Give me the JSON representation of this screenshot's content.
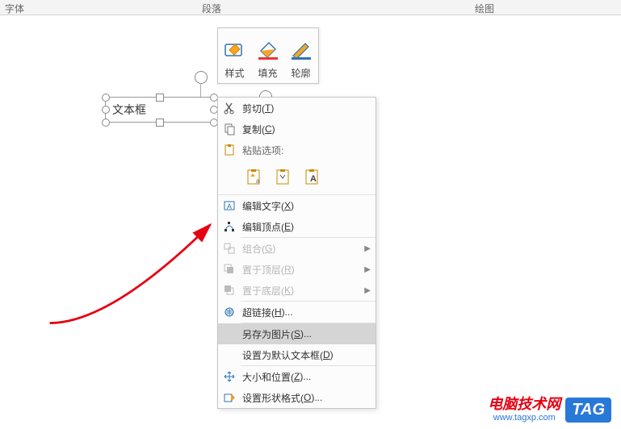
{
  "ribbon": {
    "tab1": "字体",
    "tab2": "段落",
    "tab3": "绘图"
  },
  "toolbar": {
    "btn1": "样式",
    "btn2": "填充",
    "btn3": "轮廓"
  },
  "textbox": {
    "text": "文本框"
  },
  "menu": {
    "cut": {
      "label": "剪切(",
      "accel": "T",
      "suffix": ")"
    },
    "copy": {
      "label": "复制(",
      "accel": "C",
      "suffix": ")"
    },
    "pasteHeader": "粘贴选项:",
    "editText": {
      "label": "编辑文字(",
      "accel": "X",
      "suffix": ")"
    },
    "editPoints": {
      "label": "编辑顶点(",
      "accel": "E",
      "suffix": ")"
    },
    "group": {
      "label": "组合(",
      "accel": "G",
      "suffix": ")"
    },
    "bringFront": {
      "label": "置于顶层(",
      "accel": "R",
      "suffix": ")"
    },
    "sendBack": {
      "label": "置于底层(",
      "accel": "K",
      "suffix": ")"
    },
    "hyperlink": {
      "label": "超链接(",
      "accel": "H",
      "suffix": ")..."
    },
    "saveAsPic": {
      "label": "另存为图片(",
      "accel": "S",
      "suffix": ")..."
    },
    "setDefault": {
      "label": "设置为默认文本框(",
      "accel": "D",
      "suffix": ")"
    },
    "sizePos": {
      "label": "大小和位置(",
      "accel": "Z",
      "suffix": ")..."
    },
    "formatShape": {
      "label": "设置形状格式(",
      "accel": "O",
      "suffix": ")..."
    }
  },
  "watermark": {
    "line1": "电脑技术网",
    "line2": "www.tagxp.com",
    "tag": "TAG"
  }
}
